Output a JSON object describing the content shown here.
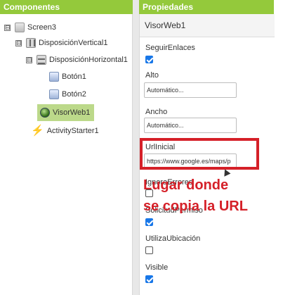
{
  "components_panel": {
    "title": "Componentes",
    "tree": [
      {
        "label": "Screen3",
        "toggle": "⊟",
        "icon": "screen-icon"
      },
      {
        "label": "DisposiciónVertical1",
        "toggle": "⊟",
        "icon": "vertical-arrangement-icon"
      },
      {
        "label": "DisposiciónHorizontal1",
        "toggle": "⊟",
        "icon": "horizontal-arrangement-icon"
      },
      {
        "label": "Botón1",
        "icon": "button-icon"
      },
      {
        "label": "Botón2",
        "icon": "button-icon"
      },
      {
        "label": "VisorWeb1",
        "icon": "webviewer-icon",
        "selected": true
      },
      {
        "label": "ActivityStarter1",
        "icon": "activity-starter-icon"
      }
    ]
  },
  "properties_panel": {
    "title": "Propiedades",
    "component_name": "VisorWeb1",
    "properties": {
      "seguir_enlaces": {
        "label": "SeguirEnlaces",
        "checked": true
      },
      "alto": {
        "label": "Alto",
        "value": "Automático..."
      },
      "ancho": {
        "label": "Ancho",
        "value": "Automático..."
      },
      "url_inicial": {
        "label": "UrlInicial",
        "value": "https://www.google.es/maps/p"
      },
      "ignora_errores": {
        "label": "IgnoraErrores",
        "checked": false
      },
      "solicitud_permiso": {
        "label": "SolicitudPermiso",
        "checked": true
      },
      "utiliza_ubicacion": {
        "label": "UtilizaUbicación",
        "checked": false
      },
      "visible": {
        "label": "Visible",
        "checked": true
      }
    }
  },
  "annotation": {
    "line1": "Lugar donde",
    "line2": "se copia la URL",
    "color": "#d52028"
  },
  "colors": {
    "header_green": "#94c93b",
    "selection_green": "#bcd98a",
    "checkbox_blue": "#1877e8"
  }
}
